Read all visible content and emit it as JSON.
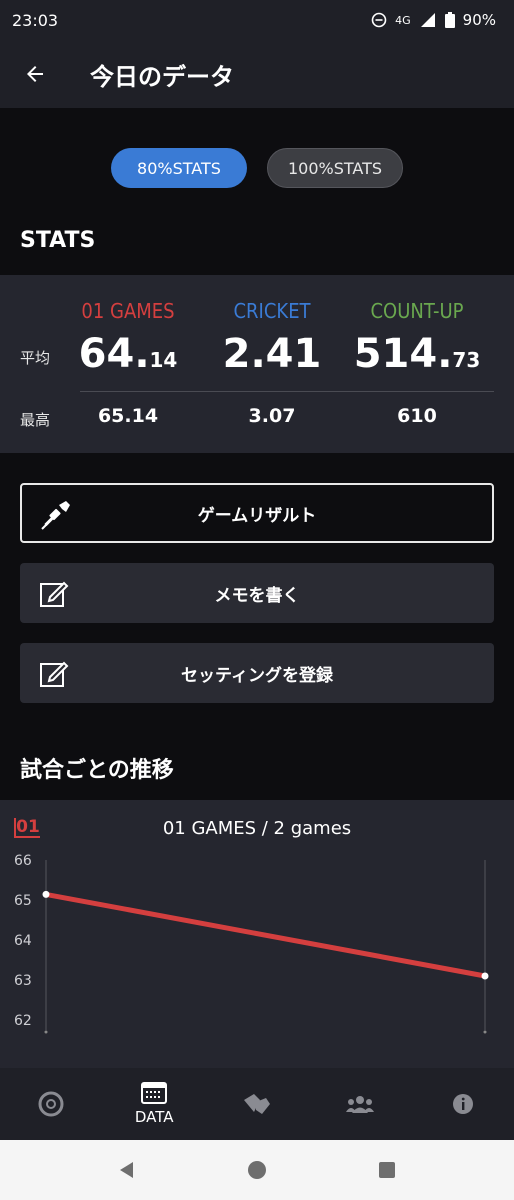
{
  "status_bar": {
    "time": "23:03",
    "network": "4G",
    "battery": "90%"
  },
  "app_bar": {
    "title": "今日のデータ"
  },
  "toggles": {
    "stats80": "80%STATS",
    "stats100": "100%STATS"
  },
  "stats": {
    "section_title": "STATS",
    "columns": [
      {
        "name": "01 GAMES",
        "color": "#d43f3f",
        "avg_int": "64.",
        "avg_dec": "14",
        "max": "65.14"
      },
      {
        "name": "CRICKET",
        "color": "#3a7bd5",
        "avg_int": "2.41",
        "avg_dec": "",
        "max": "3.07"
      },
      {
        "name": "COUNT-UP",
        "color": "#6aa84f",
        "avg_int": "514.",
        "avg_dec": "73",
        "max": "610"
      }
    ],
    "row_avg": "平均",
    "row_max": "最高"
  },
  "actions": {
    "game_result": "ゲームリザルト",
    "write_memo": "メモを書く",
    "register_setting": "セッティングを登録"
  },
  "trend": {
    "section_title": "試合ごとの推移",
    "badge": "01",
    "chart_title": "01 GAMES / 2 games"
  },
  "chart_data": {
    "type": "line",
    "title": "01 GAMES / 2 games",
    "x": [
      1,
      2
    ],
    "series": [
      {
        "values": [
          65.14,
          63.1
        ],
        "color": "#d43f3f"
      }
    ],
    "ylim": [
      62,
      66
    ],
    "yticks": [
      "66",
      "65",
      "64",
      "63",
      "62"
    ],
    "grid": false
  },
  "bottom_nav": {
    "data_label": "DATA"
  },
  "colors": {
    "accent_blue": "#3a7bd5",
    "red": "#d43f3f",
    "green": "#6aa84f"
  }
}
